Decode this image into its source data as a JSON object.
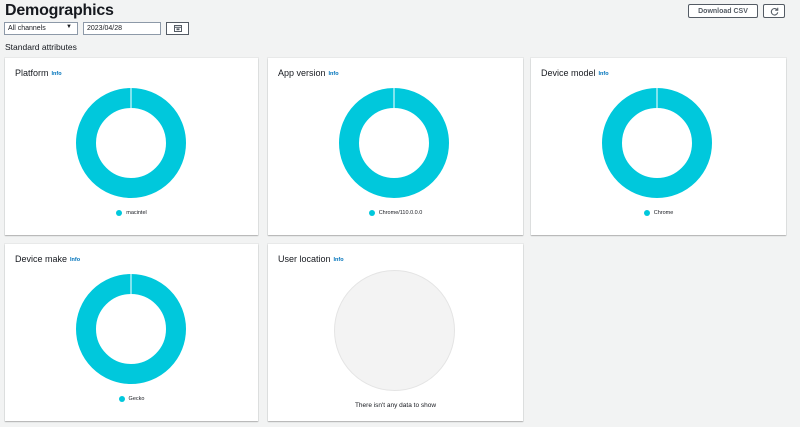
{
  "header": {
    "title": "Demographics",
    "download_label": "Download CSV",
    "refresh_icon": "refresh-icon"
  },
  "filters": {
    "channel": "All channels",
    "date": "2023/04/28",
    "calendar_icon": "calendar-icon"
  },
  "section": {
    "title": "Standard attributes"
  },
  "colors": {
    "donut": "#00c8dc",
    "accent_link": "#0073bb"
  },
  "cards": [
    {
      "title": "Platform",
      "info": "Info",
      "legend": "macintel"
    },
    {
      "title": "App version",
      "info": "Info",
      "legend": "Chrome/110.0.0.0"
    },
    {
      "title": "Device model",
      "info": "Info",
      "legend": "Chrome"
    },
    {
      "title": "Device make",
      "info": "Info",
      "legend": "Gecko"
    },
    {
      "title": "User location",
      "info": "Info",
      "empty_message": "There isn't any data to show"
    }
  ],
  "chart_data": [
    {
      "type": "pie",
      "categories": [
        "macintel"
      ],
      "values": [
        100
      ]
    },
    {
      "type": "pie",
      "categories": [
        "Chrome/110.0.0.0"
      ],
      "values": [
        100
      ]
    },
    {
      "type": "pie",
      "categories": [
        "Chrome"
      ],
      "values": [
        100
      ]
    },
    {
      "type": "pie",
      "categories": [
        "Gecko"
      ],
      "values": [
        100
      ]
    }
  ]
}
